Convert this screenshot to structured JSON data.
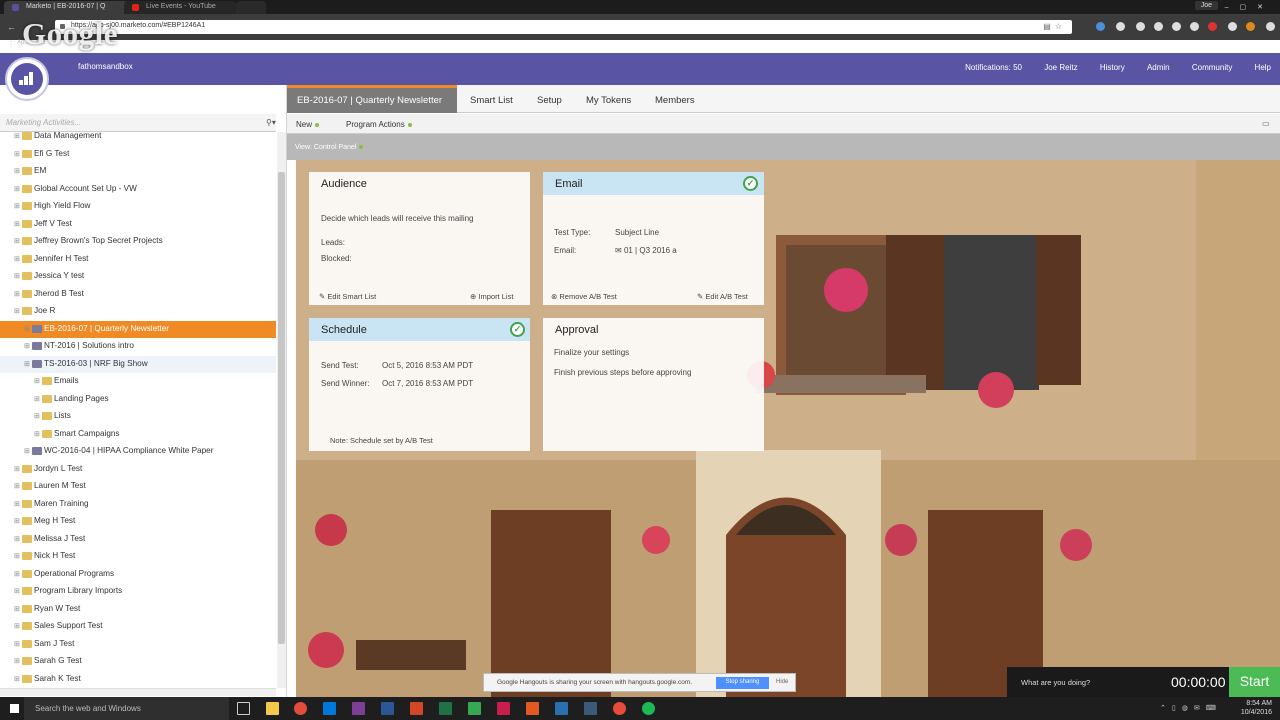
{
  "browser": {
    "tabs": [
      {
        "label": "Marketo | EB-2016-07 | Q"
      },
      {
        "label": "Live Events - YouTube"
      }
    ],
    "url": "https://app-sj00.marketo.com/#EBP1246A1",
    "profile": "Joe",
    "watermark": "Google",
    "bookmarks": "Ap... ...OM"
  },
  "marketo": {
    "workspace": "fathomsandbox",
    "nav": [
      "Notifications: 50",
      "Joe Reitz",
      "History",
      "Admin",
      "Community",
      "Help"
    ],
    "search_placeholder": "Marketing Activities...",
    "tree": [
      {
        "label": "Data Management",
        "indent": 1,
        "type": "folder",
        "partial": true
      },
      {
        "label": "Efi G Test",
        "indent": 1,
        "type": "folder"
      },
      {
        "label": "EM",
        "indent": 1,
        "type": "folder"
      },
      {
        "label": "Global Account Set Up - VW",
        "indent": 1,
        "type": "folder"
      },
      {
        "label": "High Yield Flow",
        "indent": 1,
        "type": "folder"
      },
      {
        "label": "Jeff V Test",
        "indent": 1,
        "type": "folder"
      },
      {
        "label": "Jeffrey Brown's Top Secret Projects",
        "indent": 1,
        "type": "folder"
      },
      {
        "label": "Jennifer H Test",
        "indent": 1,
        "type": "folder"
      },
      {
        "label": "Jessica Y test",
        "indent": 1,
        "type": "folder"
      },
      {
        "label": "Jherod B Test",
        "indent": 1,
        "type": "folder"
      },
      {
        "label": "Joe R",
        "indent": 1,
        "type": "folder"
      },
      {
        "label": "EB-2016-07 | Quarterly Newsletter",
        "indent": 2,
        "type": "program",
        "selected": true
      },
      {
        "label": "NT-2016 | Solutions intro",
        "indent": 2,
        "type": "program"
      },
      {
        "label": "TS-2016-03 | NRF Big Show",
        "indent": 2,
        "type": "program",
        "hover": true
      },
      {
        "label": "Emails",
        "indent": 3,
        "type": "folder"
      },
      {
        "label": "Landing Pages",
        "indent": 3,
        "type": "folder"
      },
      {
        "label": "Lists",
        "indent": 3,
        "type": "folder"
      },
      {
        "label": "Smart Campaigns",
        "indent": 3,
        "type": "folder"
      },
      {
        "label": "WC-2016-04 | HIPAA Compliance White Paper",
        "indent": 2,
        "type": "program"
      },
      {
        "label": "Jordyn L Test",
        "indent": 1,
        "type": "folder"
      },
      {
        "label": "Lauren M Test",
        "indent": 1,
        "type": "folder"
      },
      {
        "label": "Maren Training",
        "indent": 1,
        "type": "folder"
      },
      {
        "label": "Meg H Test",
        "indent": 1,
        "type": "folder"
      },
      {
        "label": "Melissa J Test",
        "indent": 1,
        "type": "folder"
      },
      {
        "label": "Nick H Test",
        "indent": 1,
        "type": "folder"
      },
      {
        "label": "Operational Programs",
        "indent": 1,
        "type": "folder"
      },
      {
        "label": "Program Library Imports",
        "indent": 1,
        "type": "folder"
      },
      {
        "label": "Ryan W Test",
        "indent": 1,
        "type": "folder"
      },
      {
        "label": "Sales Support Test",
        "indent": 1,
        "type": "folder"
      },
      {
        "label": "Sam J Test",
        "indent": 1,
        "type": "folder"
      },
      {
        "label": "Sarah G Test",
        "indent": 1,
        "type": "folder"
      },
      {
        "label": "Sarah K Test",
        "indent": 1,
        "type": "folder"
      }
    ],
    "tabs": [
      "EB-2016-07 | Quarterly Newsletter",
      "Smart List",
      "Setup",
      "My Tokens",
      "Members"
    ],
    "toolbar": {
      "new": "New",
      "actions": "Program Actions"
    },
    "view_label": "View: Control Panel",
    "cards": {
      "audience": {
        "title": "Audience",
        "desc": "Decide which leads will receive this mailing",
        "leads": "Leads:",
        "blocked": "Blocked:",
        "edit_link": "Edit Smart List",
        "import_link": "Import List"
      },
      "email": {
        "title": "Email",
        "type_label": "Test Type:",
        "type_value": "Subject Line",
        "email_label": "Email:",
        "email_value": "01 | Q3 2016 a",
        "remove_link": "Remove A/B Test",
        "edit_link": "Edit A/B Test"
      },
      "schedule": {
        "title": "Schedule",
        "send_test_label": "Send Test:",
        "send_test_value": "Oct 5, 2016 8:53 AM PDT",
        "send_winner_label": "Send Winner:",
        "send_winner_value": "Oct 7, 2016 8:53 AM PDT",
        "note": "Note: Schedule set by A/B Test"
      },
      "approval": {
        "title": "Approval",
        "line1": "Finalize your settings",
        "line2": "Finish previous steps before approving"
      }
    }
  },
  "hangouts": {
    "message": "Google Hangouts is sharing your screen with hangouts.google.com.",
    "stop": "Stop sharing",
    "hide": "Hide"
  },
  "timer": {
    "prompt": "What are you doing?",
    "time": "00:00:00",
    "start": "Start"
  },
  "taskbar": {
    "search": "Search the web and Windows",
    "time": "8:54 AM",
    "date": "10/4/2016"
  },
  "colors": {
    "marketo_purple": "#5a54a4",
    "accent_orange": "#f08a24",
    "check_green": "#3fa34d",
    "start_green": "#4cba55"
  }
}
